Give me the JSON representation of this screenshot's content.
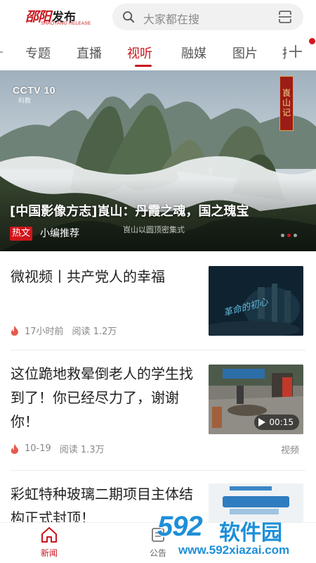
{
  "header": {
    "logo_red": "邵阳",
    "logo_black": "发布",
    "logo_sub": "SHAOYANG RELEASE",
    "search_placeholder": "大家都在搜"
  },
  "tabs": [
    {
      "label": "专题"
    },
    {
      "label": "直播"
    },
    {
      "label": "视听",
      "active": true
    },
    {
      "label": "融媒"
    },
    {
      "label": "图片"
    }
  ],
  "banner": {
    "channel": "CCTV 10",
    "channel_sub": "科教",
    "side_badge": "崀山记",
    "title": "[中国影像方志]崀山：丹霞之魂，国之瑰宝",
    "tag": "热文",
    "editor": "小编推荐",
    "caption": "崀山以圆顶密集式"
  },
  "articles": [
    {
      "title": "微视频丨共产党人的幸福",
      "time": "17小时前",
      "reads": "阅读 1.2万",
      "thumb_text": "革命的初心"
    },
    {
      "title": "这位跪地救晕倒老人的学生找到了！你已经尽力了，谢谢你！",
      "time": "10-19",
      "reads": "阅读 1.3万",
      "duration": "00:15",
      "category": "视频"
    },
    {
      "title": "彩虹特种玻璃二期项目主体结构正式封顶！"
    }
  ],
  "bottom_nav": [
    {
      "label": "新闻",
      "active": true
    },
    {
      "label": "公告"
    }
  ],
  "watermark": {
    "number": "592",
    "name": "软件园",
    "url": "www.592xiazai.com"
  },
  "colors": {
    "brand_red": "#c8161e",
    "watermark_blue": "#1d8fd8"
  }
}
